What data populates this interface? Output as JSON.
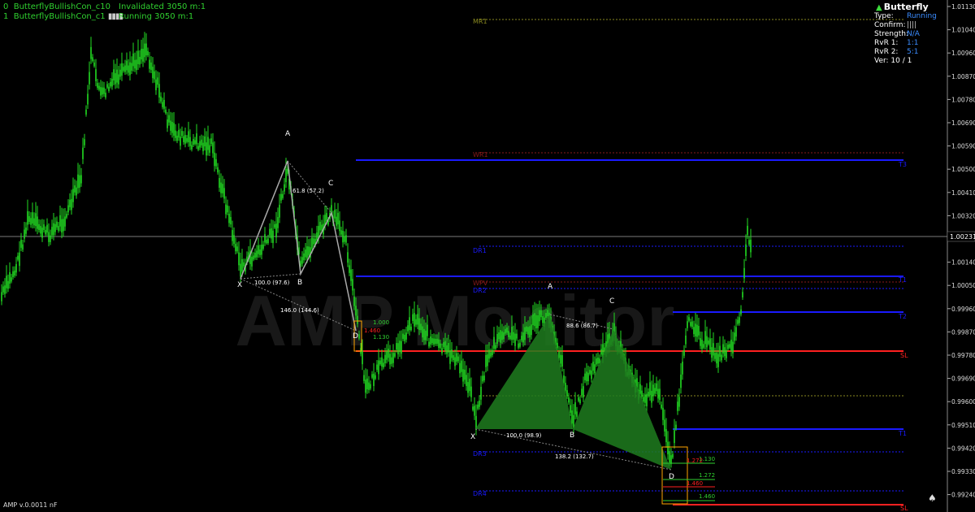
{
  "header": {
    "rows": [
      {
        "index": "0",
        "name": "ButterflyBullishCon_c10",
        "status": "Invalidated 3050 m:1",
        "bars": ""
      },
      {
        "index": "1",
        "name": "ButterflyBullishCon_c1",
        "status": "Running 3050 m:1",
        "bars": "▮▮▮▮"
      }
    ]
  },
  "info_panel": {
    "title": "Butterfly",
    "rows": [
      {
        "label": "Type:",
        "value": "Running"
      },
      {
        "label": "Confirm:",
        "value": "||||"
      },
      {
        "label": "Strength:",
        "value": "N/A"
      },
      {
        "label": "RvR 1:",
        "value": "1:1"
      },
      {
        "label": "RvR 2:",
        "value": "5:1"
      },
      {
        "label": "Ver: 10 / 1",
        "value": ""
      }
    ]
  },
  "watermark": "AMP Monitor",
  "footer": "AMP v.0.0011 nF",
  "price_axis": {
    "ticks": [
      "1.01130",
      "1.01040",
      "1.00960",
      "1.00870",
      "1.00780",
      "1.00690",
      "1.00590",
      "1.00500",
      "1.00410",
      "1.00320",
      "1.00231",
      "1.00140",
      "1.00050",
      "0.99960",
      "0.99870",
      "0.99780",
      "0.99690",
      "0.99600",
      "0.99510",
      "0.99420",
      "0.99330",
      "0.99240"
    ],
    "current_price": "1.00231"
  },
  "levels": {
    "mr1": "MR1",
    "wr1": "WR1",
    "dr1": "DR1",
    "wpv": "WPV",
    "dr2": "DR2",
    "dr3": "DR3",
    "dr4": "DR4",
    "t1": "T1",
    "t2": "T2",
    "t3": "T3",
    "sl": "SL"
  },
  "pattern1": {
    "X": "X",
    "A": "A",
    "B": "B",
    "C": "C",
    "D": "D",
    "ab": "61.8 (57.2)",
    "xb": "100.0 (97.6)",
    "xd": "146.0 (144.6)",
    "fib1": "1.000",
    "fib2": "1.460",
    "fib3": "1.130"
  },
  "pattern2": {
    "X": "X",
    "A": "A",
    "B": "B",
    "C": "C",
    "D": "D",
    "ac": "88.6 (86.7)",
    "xb": "100.0 (98.9)",
    "xd": "138.2 (132.7)",
    "fib1": "1.130",
    "fib2": "1.272",
    "fib3": "1.272",
    "fib4": "1.460",
    "fib5": "1.460"
  },
  "colors": {
    "candle": "#22dd22",
    "target_line": "#1a1aff",
    "sl_line": "#ff2020",
    "pattern_fill": "#1f7d1f",
    "box": "#ffa500"
  }
}
